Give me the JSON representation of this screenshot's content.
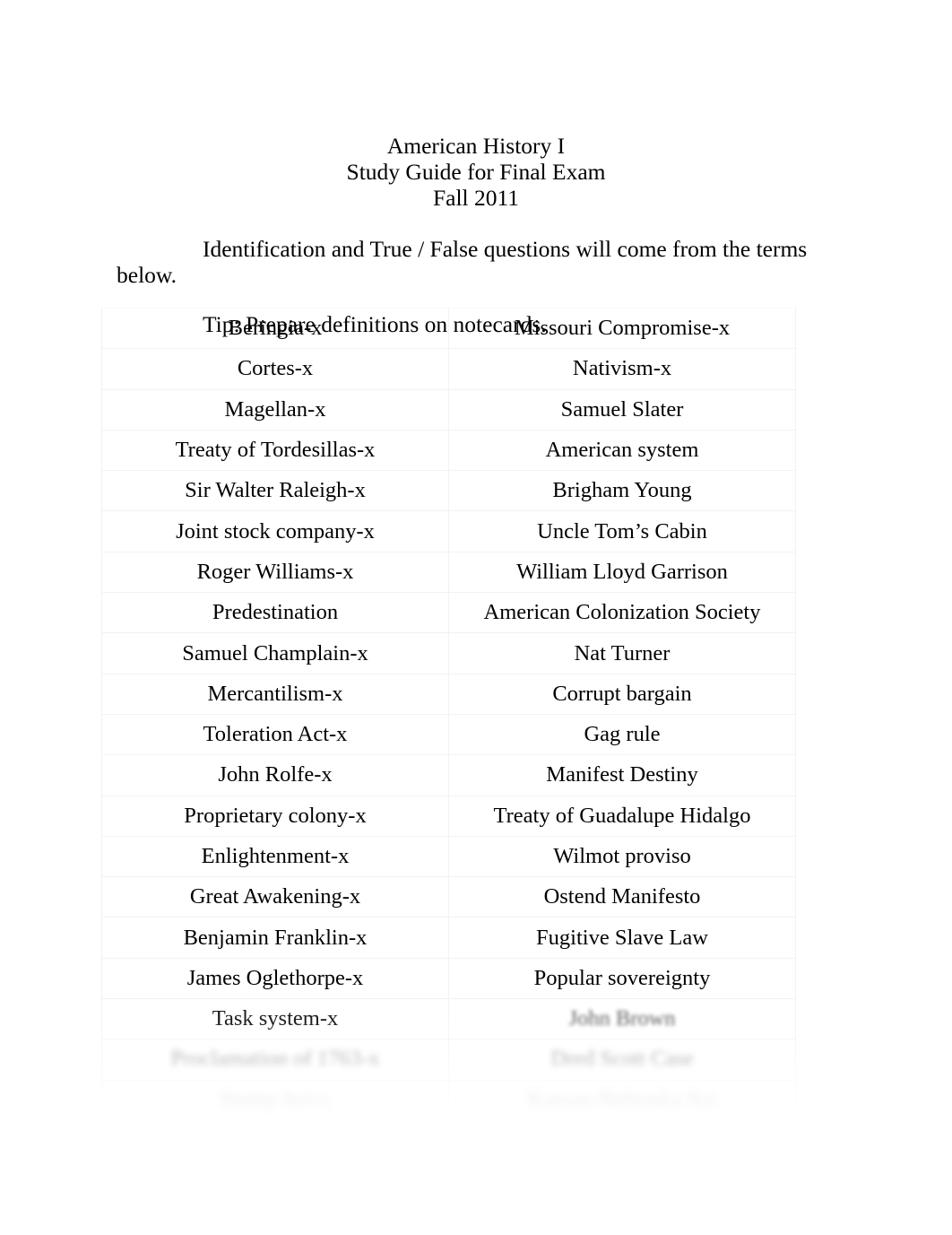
{
  "document": {
    "title_lines": [
      "American History I",
      "Study Guide for Final Exam",
      "Fall 2011"
    ],
    "intro_paragraph": "Identification and True / False questions will come from the terms below.",
    "tip_line": "Tip:  Prepare definitions on notecards."
  },
  "terms_table": {
    "rows": [
      {
        "left": "Beringia-x",
        "right": "Missouri Compromise-x"
      },
      {
        "left": "Cortes-x",
        "right": "Nativism-x"
      },
      {
        "left": "Magellan-x",
        "right": "Samuel Slater"
      },
      {
        "left": "Treaty of Tordesillas-x",
        "right": "American system"
      },
      {
        "left": "Sir Walter Raleigh-x",
        "right": "Brigham Young"
      },
      {
        "left": "Joint stock company-x",
        "right": "Uncle Tom’s Cabin"
      },
      {
        "left": "Roger Williams-x",
        "right": "William Lloyd Garrison"
      },
      {
        "left": "Predestination",
        "right": "American Colonization Society"
      },
      {
        "left": "Samuel Champlain-x",
        "right": "Nat Turner"
      },
      {
        "left": "Mercantilism-x",
        "right": "Corrupt bargain"
      },
      {
        "left": "Toleration Act-x",
        "right": "Gag rule"
      },
      {
        "left": "John Rolfe-x",
        "right": "Manifest Destiny"
      },
      {
        "left": "Proprietary colony-x",
        "right": "Treaty of Guadalupe Hidalgo"
      },
      {
        "left": "Enlightenment-x",
        "right": "Wilmot proviso"
      },
      {
        "left": "Great Awakening-x",
        "right": "Ostend Manifesto"
      },
      {
        "left": "Benjamin Franklin-x",
        "right": "Fugitive Slave Law"
      },
      {
        "left": "James Oglethorpe-x",
        "right": "Popular sovereignty"
      },
      {
        "left": "Task system-x",
        "right": "John Brown"
      },
      {
        "left": "Proclamation of 1763-x",
        "right": "Dred Scott Case"
      },
      {
        "left": "Stamp Act-x",
        "right": "Kansas-Nebraska Act"
      }
    ]
  }
}
